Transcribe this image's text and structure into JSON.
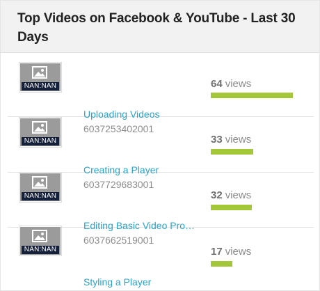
{
  "widget": {
    "title": "Top Videos on Facebook & YouTube - Last 30 Days",
    "views_unit": "views",
    "accent_color": "#a4c639",
    "link_color": "#2aa3c9"
  },
  "videos": [
    {
      "thumb_duration": "NAN:NAN",
      "views": "64",
      "views_fraction": 1.0,
      "title": "Uploading Videos",
      "id": "6037253402001"
    },
    {
      "thumb_duration": "NAN:NAN",
      "views": "33",
      "views_fraction": 0.516,
      "title": "Creating a Player",
      "id": "6037729683001"
    },
    {
      "thumb_duration": "NAN:NAN",
      "views": "32",
      "views_fraction": 0.5,
      "title": "Editing Basic Video Pro…",
      "id": "6037662519001"
    },
    {
      "thumb_duration": "NAN:NAN",
      "views": "17",
      "views_fraction": 0.266,
      "title": "Styling a Player",
      "id": ""
    }
  ]
}
